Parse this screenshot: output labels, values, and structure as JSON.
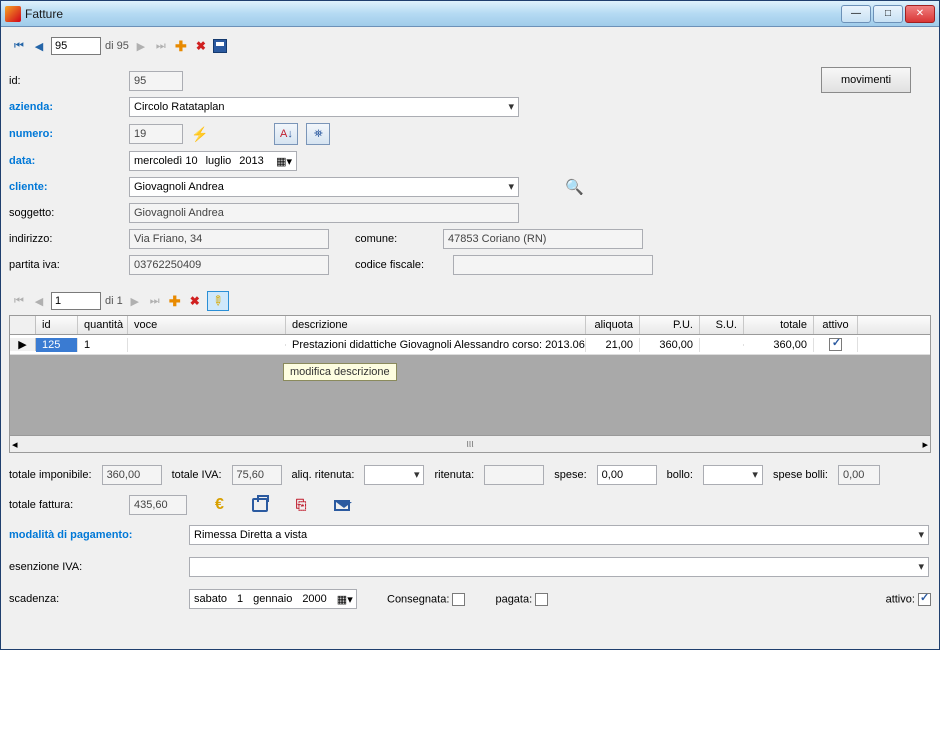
{
  "window": {
    "title": "Fatture"
  },
  "topnav": {
    "pos": "95",
    "of_label": "di 95"
  },
  "movimenti_label": "movimenti",
  "labels": {
    "id": "id:",
    "azienda": "azienda:",
    "numero": "numero:",
    "data": "data:",
    "cliente": "cliente:",
    "soggetto": "soggetto:",
    "indirizzo": "indirizzo:",
    "comune": "comune:",
    "partita_iva": "partita iva:",
    "codice_fiscale": "codice fiscale:",
    "totale_imponibile": "totale imponibile:",
    "totale_iva": "totale IVA:",
    "aliq_ritenuta": "aliq. ritenuta:",
    "ritenuta": "ritenuta:",
    "spese": "spese:",
    "bollo": "bollo:",
    "spese_bolli": "spese bolli:",
    "totale_fattura": "totale fattura:",
    "modalita_pagamento": "modalità di pagamento:",
    "esenzione_iva": "esenzione IVA:",
    "scadenza": "scadenza:",
    "consegnata": "Consegnata:",
    "pagata": "pagata:",
    "attivo": "attivo:"
  },
  "form": {
    "id": "95",
    "azienda": "Circolo Ratataplan",
    "numero": "19",
    "data_day_name": "mercoledì 10",
    "data_month": "luglio",
    "data_year": "2013",
    "cliente": "Giovagnoli Andrea",
    "soggetto": "Giovagnoli Andrea",
    "indirizzo": "Via Friano, 34",
    "comune": "47853 Coriano (RN)",
    "partita_iva": "03762250409",
    "codice_fiscale": ""
  },
  "grid": {
    "nav": {
      "pos": "1",
      "of_label": "di 1"
    },
    "headers": {
      "id": "id",
      "quantita": "quantità",
      "voce": "voce",
      "descrizione": "descrizione",
      "aliquota": "aliquota",
      "pu": "P.U.",
      "su": "S.U.",
      "totale": "totale",
      "attivo": "attivo"
    },
    "rows": [
      {
        "id": "125",
        "quantita": "1",
        "voce": "",
        "descrizione": "Prestazioni didattiche Giovagnoli Alessandro corso: 2013.06....",
        "aliquota": "21,00",
        "pu": "360,00",
        "su": "",
        "totale": "360,00",
        "attivo": true
      }
    ],
    "tooltip": "modifica descrizione"
  },
  "totals": {
    "imponibile": "360,00",
    "iva": "75,60",
    "aliq_ritenuta": "",
    "ritenuta": "",
    "spese": "0,00",
    "bollo": "",
    "spese_bolli": "0,00",
    "fattura": "435,60"
  },
  "bottom": {
    "modalita_pagamento": "Rimessa Diretta a vista",
    "esenzione_iva": "",
    "scadenza_day_name": "sabato",
    "scadenza_day": "1",
    "scadenza_month": "gennaio",
    "scadenza_year": "2000",
    "consegnata": false,
    "pagata": false,
    "attivo": true
  }
}
